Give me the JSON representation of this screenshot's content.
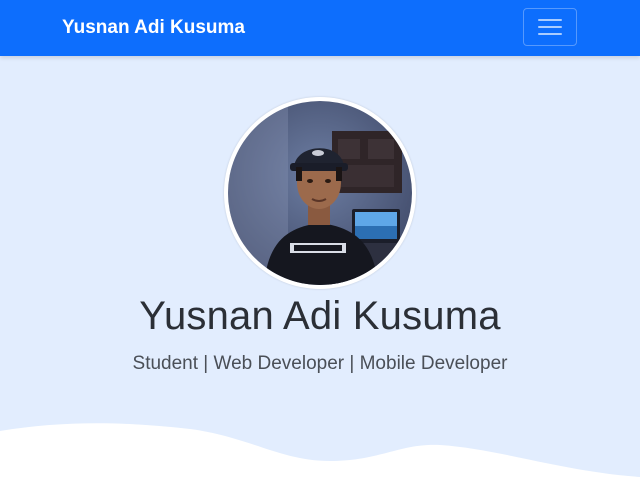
{
  "navbar": {
    "brand": "Yusnan Adi Kusuma",
    "background": "#0d6efd",
    "toggler_icon": "hamburger-menu-icon"
  },
  "hero": {
    "name": "Yusnan Adi Kusuma",
    "tagline": "Student | Web Developer | Mobile Developer",
    "background": "#e2edfe",
    "avatar": "profile-photo"
  }
}
